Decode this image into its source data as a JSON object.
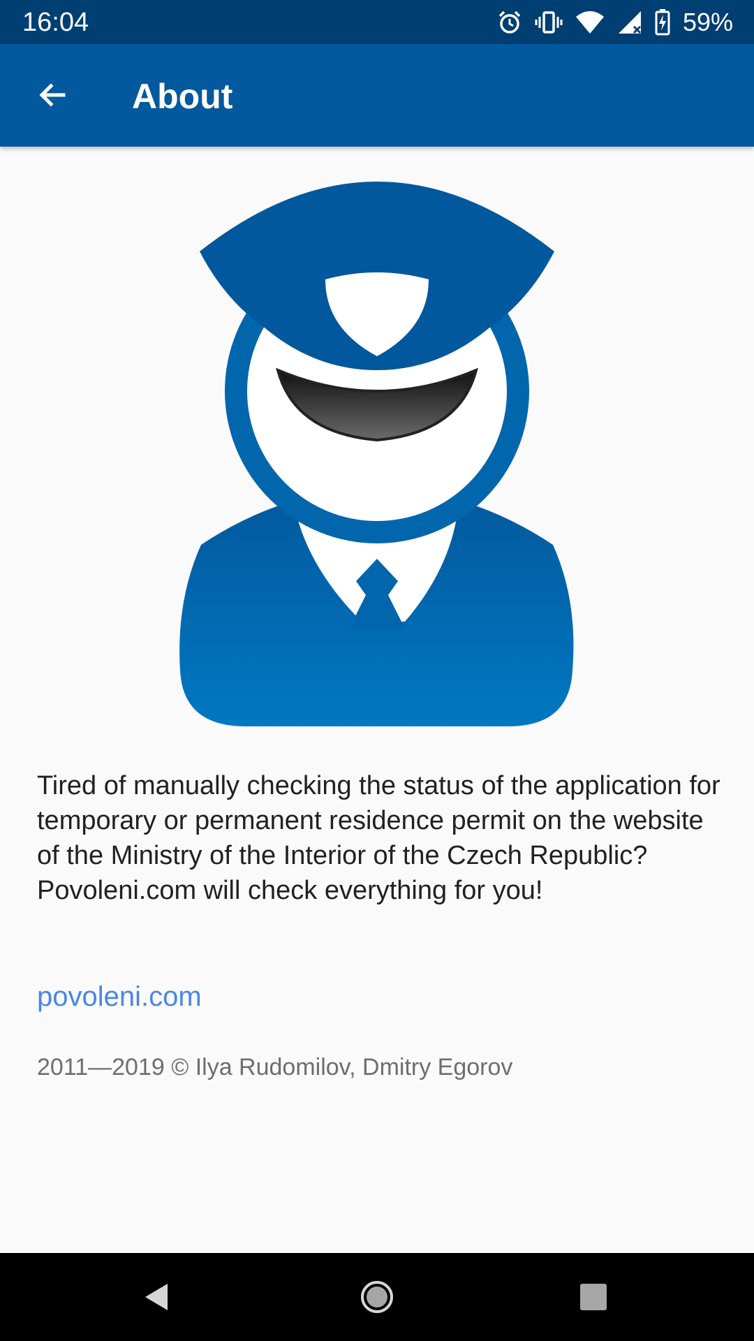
{
  "status_bar": {
    "time": "16:04",
    "battery": "59%",
    "icons": [
      "alarm-icon",
      "vibrate-icon",
      "wifi-icon",
      "signal-icon",
      "battery-charging-icon"
    ]
  },
  "app_bar": {
    "title": "About",
    "back_icon": "arrow-back-icon"
  },
  "content": {
    "mascot_icon": "police-officer-icon",
    "description": "Tired of manually checking the status of the application for temporary or permanent residence permit on the website of the Ministry of the Interior of the Czech Republic? Povoleni.com will check everything for you!",
    "link": "povoleni.com",
    "copyright": "2011—2019 © Ilya Rudomilov, Dmitry Egorov"
  },
  "nav_bar": {
    "icons": [
      "nav-back-icon",
      "nav-home-icon",
      "nav-recents-icon"
    ]
  },
  "colors": {
    "status_bar": "#003f72",
    "app_bar": "#02599d",
    "mascot_blue": "#0267ae",
    "link": "#4a86e8",
    "background": "#fafafa"
  }
}
